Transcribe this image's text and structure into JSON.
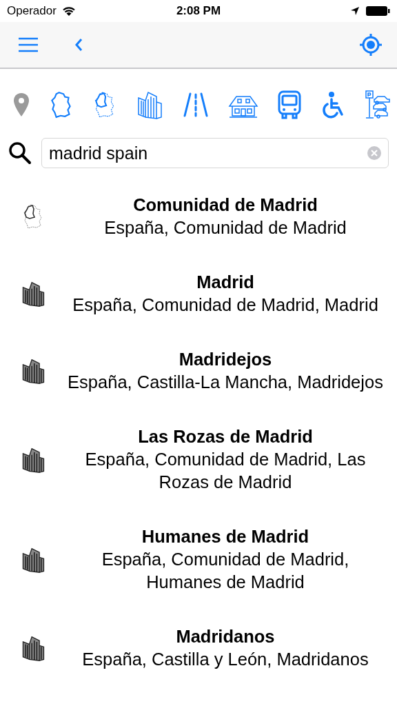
{
  "status_bar": {
    "carrier": "Operador",
    "time": "2:08 PM"
  },
  "filters": [
    {
      "kind": "pin",
      "on": false
    },
    {
      "kind": "country",
      "on": true
    },
    {
      "kind": "region",
      "on": true
    },
    {
      "kind": "city",
      "on": true
    },
    {
      "kind": "road",
      "on": true
    },
    {
      "kind": "house",
      "on": true
    },
    {
      "kind": "bus",
      "on": true
    },
    {
      "kind": "wheelchair",
      "on": true
    },
    {
      "kind": "parking",
      "on": true
    }
  ],
  "search": {
    "value": "madrid spain"
  },
  "results": [
    {
      "kind": "region",
      "title": "Comunidad de Madrid",
      "subtitle": "España, Comunidad de Madrid"
    },
    {
      "kind": "city",
      "title": "Madrid",
      "subtitle": "España, Comunidad de Madrid, Madrid"
    },
    {
      "kind": "city",
      "title": "Madridejos",
      "subtitle": "España, Castilla-La Mancha, Madridejos"
    },
    {
      "kind": "city",
      "title": "Las Rozas de Madrid",
      "subtitle": "España, Comunidad de Madrid, Las Rozas de Madrid"
    },
    {
      "kind": "city",
      "title": "Humanes de Madrid",
      "subtitle": "España, Comunidad de Madrid, Humanes de Madrid"
    },
    {
      "kind": "city",
      "title": "Madridanos",
      "subtitle": "España, Castilla y León, Madridanos"
    }
  ]
}
